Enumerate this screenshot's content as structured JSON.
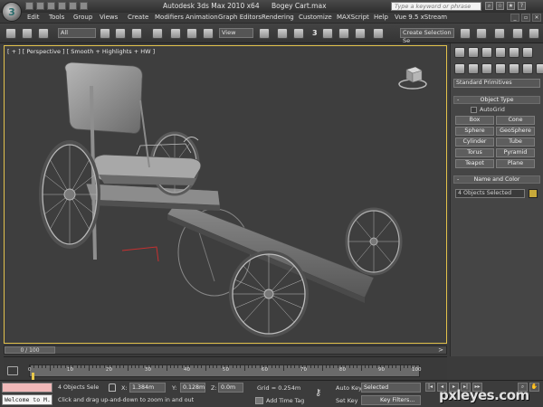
{
  "window": {
    "app_title": "Autodesk 3ds Max  2010 x64",
    "file_name": "Bogey Cart.max",
    "search_placeholder": "Type a keyword or phrase"
  },
  "menu": {
    "items": [
      "Edit",
      "Tools",
      "Group",
      "Views",
      "Create",
      "Modifiers",
      "Animation",
      "Graph Editors",
      "Rendering",
      "Customize",
      "MAXScript",
      "Help",
      "Vue 9.5 xStream"
    ]
  },
  "toolbar": {
    "selection_filter": "All",
    "reference_coord": "View",
    "snap_label": "3",
    "named_selection": "Create Selection Se"
  },
  "viewport": {
    "label": "[ + ] [ Perspective ] [ Smooth + Highlights + HW ]",
    "border_color": "#e3c24c"
  },
  "command_panel": {
    "category_dropdown": "Standard Primitives",
    "object_type": {
      "header": "Object Type",
      "autogrid": "AutoGrid",
      "buttons": [
        "Box",
        "Cone",
        "Sphere",
        "GeoSphere",
        "Cylinder",
        "Tube",
        "Torus",
        "Pyramid",
        "Teapot",
        "Plane"
      ]
    },
    "name_color": {
      "header": "Name and Color",
      "name_value": "4 Objects Selected",
      "swatch_color": "#c8a93a"
    }
  },
  "timeline": {
    "frame_display": "0 / 100",
    "ticks": [
      "0",
      "10",
      "20",
      "30",
      "40",
      "50",
      "60",
      "70",
      "80",
      "90",
      "100"
    ]
  },
  "status": {
    "listener_text": "Welcome to M.",
    "selection_count": "4 Objects Sele",
    "prompt": "Click and drag up-and-down to zoom in and out",
    "x_label": "X:",
    "x_value": "1.384m",
    "y_label": "Y:",
    "y_value": "0.128m",
    "z_label": "Z:",
    "z_value": "0.0m",
    "grid": "Grid = 0.254m",
    "add_time_tag": "Add Time Tag",
    "auto_key": "Auto Key",
    "auto_key_dropdown": "Selected",
    "set_key": "Set Key",
    "key_filters": "Key Filters..."
  },
  "watermark": "pxleyes.com",
  "icons": [
    "app-logo-icon",
    "undo-icon",
    "redo-icon",
    "link-icon",
    "unlink-icon",
    "bind-icon",
    "select-icon",
    "select-by-name-icon",
    "region-select-icon",
    "window-crossing-icon",
    "move-icon",
    "rotate-icon",
    "scale-icon",
    "pivot-icon",
    "manipulate-icon",
    "snap-icon",
    "angle-snap-icon",
    "percent-snap-icon",
    "spinner-snap-icon",
    "mirror-icon",
    "align-icon",
    "layer-icon",
    "curve-editor-icon",
    "material-editor-icon",
    "render-setup-icon",
    "render-icon",
    "viewcube-icon",
    "lock-icon",
    "key-icon",
    "play-icon"
  ]
}
